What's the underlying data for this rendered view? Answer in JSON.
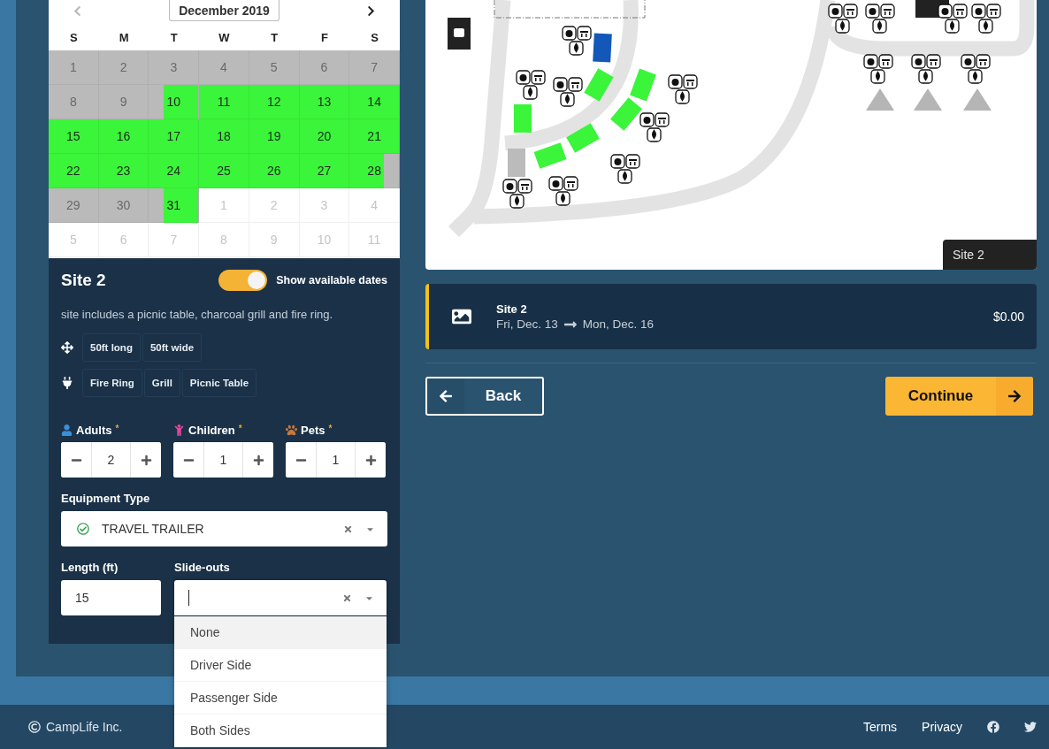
{
  "calendar": {
    "prev_disabled": true,
    "month": "December 2019",
    "weekdays": [
      "S",
      "M",
      "T",
      "W",
      "T",
      "F",
      "S"
    ],
    "days": [
      {
        "label": "1",
        "kind": "unavailable"
      },
      {
        "label": "2",
        "kind": "unavailable"
      },
      {
        "label": "3",
        "kind": "unavailable"
      },
      {
        "label": "4",
        "kind": "unavailable"
      },
      {
        "label": "5",
        "kind": "unavailable"
      },
      {
        "label": "6",
        "kind": "unavailable"
      },
      {
        "label": "7",
        "kind": "unavailable"
      },
      {
        "label": "8",
        "kind": "unavailable"
      },
      {
        "label": "9",
        "kind": "unavailable"
      },
      {
        "label": "10",
        "kind": "checkin"
      },
      {
        "label": "11",
        "kind": "available"
      },
      {
        "label": "12",
        "kind": "available"
      },
      {
        "label": "13",
        "kind": "available"
      },
      {
        "label": "14",
        "kind": "available"
      },
      {
        "label": "15",
        "kind": "available"
      },
      {
        "label": "16",
        "kind": "available"
      },
      {
        "label": "17",
        "kind": "available"
      },
      {
        "label": "18",
        "kind": "available"
      },
      {
        "label": "19",
        "kind": "available"
      },
      {
        "label": "20",
        "kind": "available"
      },
      {
        "label": "21",
        "kind": "available"
      },
      {
        "label": "22",
        "kind": "available"
      },
      {
        "label": "23",
        "kind": "available"
      },
      {
        "label": "24",
        "kind": "available"
      },
      {
        "label": "25",
        "kind": "available"
      },
      {
        "label": "26",
        "kind": "available"
      },
      {
        "label": "27",
        "kind": "available"
      },
      {
        "label": "28",
        "kind": "checkout"
      },
      {
        "label": "29",
        "kind": "unavailable"
      },
      {
        "label": "30",
        "kind": "unavailable"
      },
      {
        "label": "31",
        "kind": "checkin"
      },
      {
        "label": "1",
        "kind": "outside"
      },
      {
        "label": "2",
        "kind": "outside"
      },
      {
        "label": "3",
        "kind": "outside"
      },
      {
        "label": "4",
        "kind": "outside"
      },
      {
        "label": "5",
        "kind": "outside"
      },
      {
        "label": "6",
        "kind": "outside"
      },
      {
        "label": "7",
        "kind": "outside"
      },
      {
        "label": "8",
        "kind": "outside"
      },
      {
        "label": "9",
        "kind": "outside"
      },
      {
        "label": "10",
        "kind": "outside"
      },
      {
        "label": "11",
        "kind": "outside"
      }
    ]
  },
  "site": {
    "title": "Site 2",
    "toggle": {
      "label": "Show available dates",
      "on": true
    },
    "description": "site includes a picnic table, charcoal grill and fire ring.",
    "size_tags": [
      "50ft long",
      "50ft wide"
    ],
    "amenity_tags": [
      "Fire Ring",
      "Grill",
      "Picnic Table"
    ]
  },
  "counters": [
    {
      "kind": "adults",
      "label": "Adults",
      "required_mark": "*",
      "value": "2"
    },
    {
      "kind": "children",
      "label": "Children",
      "required_mark": "*",
      "value": "1"
    },
    {
      "kind": "pets",
      "label": "Pets",
      "required_mark": "*",
      "value": "1"
    }
  ],
  "equipment": {
    "label": "Equipment Type",
    "value": "TRAVEL TRAILER"
  },
  "length": {
    "label": "Length (ft)",
    "value": "15"
  },
  "slideouts": {
    "label": "Slide-outs",
    "options": [
      {
        "label": "None",
        "highlighted": true
      },
      {
        "label": "Driver Side",
        "highlighted": false
      },
      {
        "label": "Passenger Side",
        "highlighted": false
      },
      {
        "label": "Both Sides",
        "highlighted": false
      }
    ]
  },
  "map": {
    "site_label": "Site 2"
  },
  "booking": {
    "site": "Site 2",
    "from": "Fri, Dec. 13",
    "to": "Mon, Dec. 16",
    "price": "$0.00"
  },
  "actions": {
    "back": "Back",
    "continue": "Continue"
  },
  "footer": {
    "copyright": "CampLife Inc.",
    "links": [
      "Terms",
      "Privacy"
    ]
  }
}
